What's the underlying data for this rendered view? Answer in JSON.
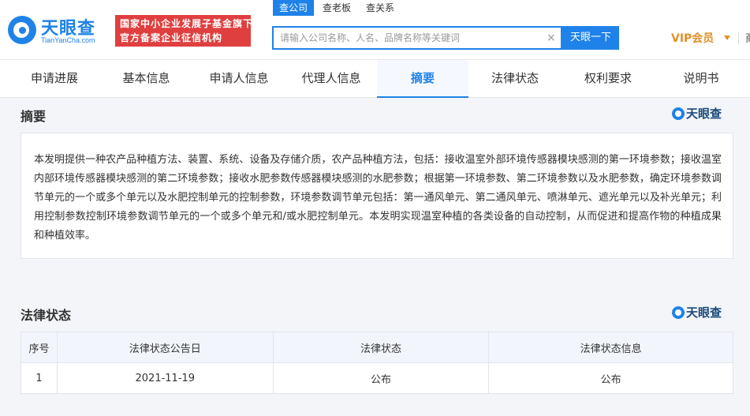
{
  "header": {
    "logo_name": "天眼查",
    "logo_sub": "TianYanCha.com",
    "promo_line1": "国家中小企业发展子基金旗下",
    "promo_line2": "官方备案企业征信机构",
    "search_tabs": [
      "查公司",
      "查老板",
      "查关系"
    ],
    "search_placeholder": "请输入公司名称、人名、品牌名称等关键词",
    "clear_glyph": "×",
    "search_button": "天眼一下",
    "vip_label": "VIP会员",
    "edge_text": "商"
  },
  "nav": {
    "items": [
      "申请进展",
      "基本信息",
      "申请人信息",
      "代理人信息",
      "摘要",
      "法律状态",
      "权利要求",
      "说明书"
    ],
    "active": "摘要"
  },
  "abstract": {
    "title": "摘要",
    "brand": "天眼查",
    "text": "本发明提供一种农产品种植方法、装置、系统、设备及存储介质，农产品种植方法，包括：接收温室外部环境传感器模块感测的第一环境参数；接收温室内部环境传感器模块感测的第二环境参数；接收水肥参数传感器模块感测的水肥参数；根据第一环境参数、第二环境参数以及水肥参数，确定环境参数调节单元的一个或多个单元以及水肥控制单元的控制参数，环境参数调节单元包括：第一通风单元、第二通风单元、喷淋单元、遮光单元以及补光单元；利用控制参数控制环境参数调节单元的一个或多个单元和/或水肥控制单元。本发明实现温室种植的各类设备的自动控制，从而促进和提高作物的种植成果和种植效率。"
  },
  "legal": {
    "title": "法律状态",
    "brand": "天眼查",
    "columns": [
      "序号",
      "法律状态公告日",
      "法律状态",
      "法律状态信息"
    ],
    "rows": [
      [
        "1",
        "2021-11-19",
        "公布",
        "公布"
      ]
    ]
  },
  "colors": {
    "brand_blue": "#1f82e8",
    "promo_red": "#e03f3f",
    "vip_gold": "#e0912b"
  }
}
